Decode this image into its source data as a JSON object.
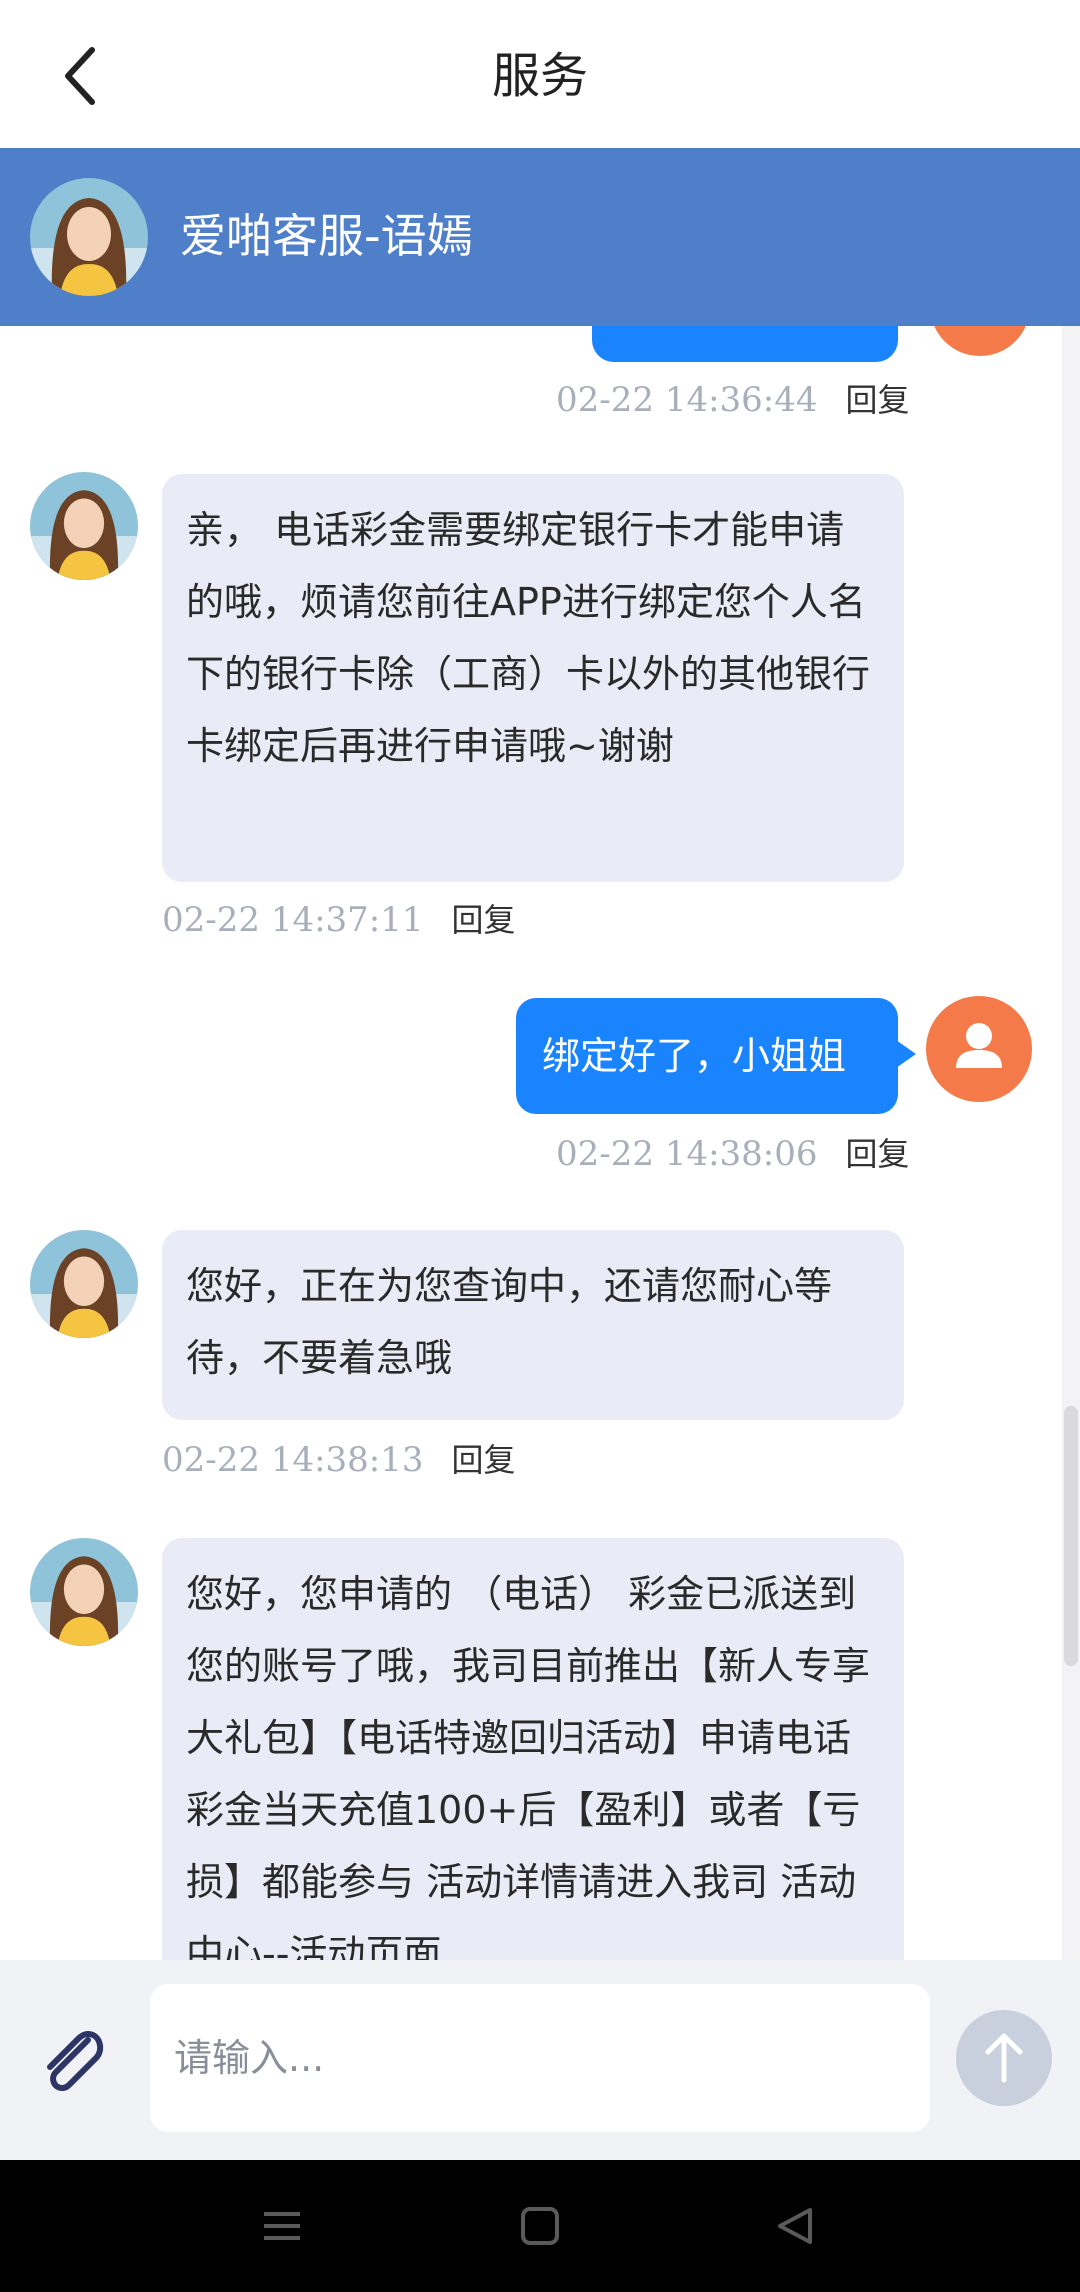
{
  "topbar": {
    "title": "服务"
  },
  "agent": {
    "name": "爱啪客服-语嫣"
  },
  "messages": [
    {
      "time": "02-22 14:36:44",
      "reply": "回复"
    },
    {
      "text": "亲， 电话彩金需要绑定银行卡才能申请的哦，烦请您前往APP进行绑定您个人名下的银行卡除（工商）卡以外的其他银行卡绑定后再进行申请哦~谢谢",
      "time": "02-22 14:37:11",
      "reply": "回复"
    },
    {
      "text": "绑定好了，小姐姐",
      "time": "02-22 14:38:06",
      "reply": "回复"
    },
    {
      "text": "您好，正在为您查询中，还请您耐心等待，不要着急哦",
      "time": "02-22 14:38:13",
      "reply": "回复"
    },
    {
      "text": "您好，您申请的 （电话） 彩金已派送到您的账号了哦，我司目前推出【新人专享大礼包】【电话特邀回归活动】申请电话彩金当天充值100+后【盈利】或者【亏损】都能参与 活动详情请进入我司 活动中心--活动页面"
    }
  ],
  "input": {
    "placeholder": "请输入..."
  },
  "colors": {
    "header": "#4f7fc8",
    "outgoing_bubble": "#1a84ff",
    "incoming_bubble": "#e9ecf6",
    "user_avatar": "#f57a49"
  },
  "icons": [
    "back-icon",
    "user-icon",
    "paperclip-icon",
    "arrow-up-icon",
    "menu-icon",
    "home-icon",
    "back-triangle-icon"
  ]
}
